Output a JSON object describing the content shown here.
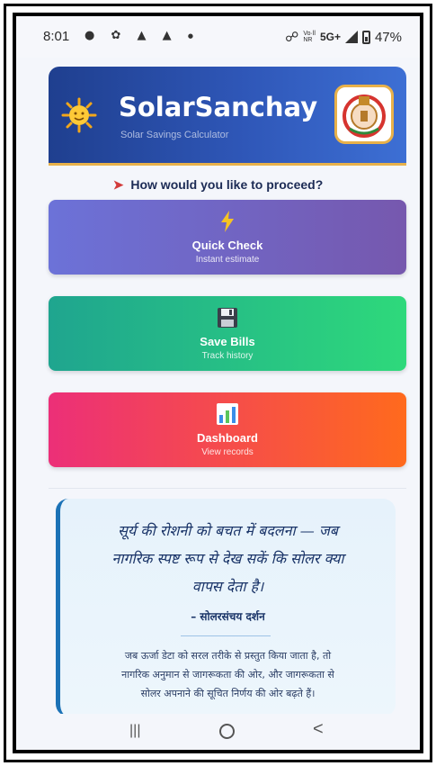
{
  "status_bar": {
    "time": "8:01",
    "left_icons": [
      "chat-icon",
      "pinwheel-icon",
      "emblem-icon",
      "emblem-icon",
      "dot-icon"
    ],
    "link_glyph": "☍",
    "volte_top": "Vo·ll",
    "volte_bottom": "NR",
    "network": "5G+",
    "battery_percent": "47%"
  },
  "header": {
    "title": "SolarSanchay",
    "subtitle": "Solar Savings Calculator",
    "accent": "#e8b14a"
  },
  "prompt": {
    "icon": "rocket-icon",
    "text": "How would you like to proceed?"
  },
  "cards": [
    {
      "icon": "lightning-icon",
      "title": "Quick Check",
      "subtitle": "Instant estimate",
      "colors": [
        "#6c72d8",
        "#7658ae"
      ]
    },
    {
      "icon": "floppy-disk-icon",
      "title": "Save Bills",
      "subtitle": "Track history",
      "colors": [
        "#1fa58f",
        "#2ed97b"
      ]
    },
    {
      "icon": "bar-chart-icon",
      "title": "Dashboard",
      "subtitle": "View records",
      "colors": [
        "#ec2f78",
        "#ff6a1d"
      ]
    }
  ],
  "quote": {
    "line1": "सूर्य की रोशनी को बचत में बदलना — जब",
    "line2": "नागरिक स्पष्ट रूप से देख सकें कि सोलर क्या",
    "line3": "वापस देता है।",
    "author": "– सोलरसंचय दर्शन",
    "body1": "जब ऊर्जा डेटा को सरल तरीके से प्रस्तुत किया जाता है, तो",
    "body2": "नागरिक अनुमान से जागरूकता की ओर, और जागरूकता से",
    "body3": "सोलर अपनाने की सूचित निर्णय की ओर बढ़ते हैं।"
  },
  "nav": {
    "recents": "|||",
    "back": "<"
  }
}
